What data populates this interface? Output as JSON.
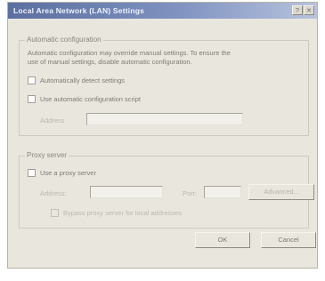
{
  "window": {
    "title": "Local Area Network (LAN) Settings",
    "help_button": "?",
    "close_button": "x"
  },
  "automatic_configuration": {
    "group_label": "Automatic configuration",
    "description_line1": "Automatic configuration may override manual settings.  To ensure the",
    "description_line2": "use of manual settings, disable automatic configuration.",
    "auto_detect_label": "Automatically detect settings",
    "auto_detect_checked": false,
    "script_label": "Use automatic configuration script",
    "script_checked": false,
    "address_label": "Address",
    "address_value": ""
  },
  "proxy_server": {
    "group_label": "Proxy server",
    "use_proxy_label": "Use a proxy server",
    "use_proxy_checked": false,
    "address_label": "Address:",
    "address_value": "",
    "port_label": "Port:",
    "port_value": "",
    "advanced_label": "Advanced...",
    "bypass_label": "Bypass proxy server for local addresses",
    "bypass_checked": false
  },
  "footer": {
    "ok_label": "OK",
    "cancel_label": "Cancel"
  }
}
